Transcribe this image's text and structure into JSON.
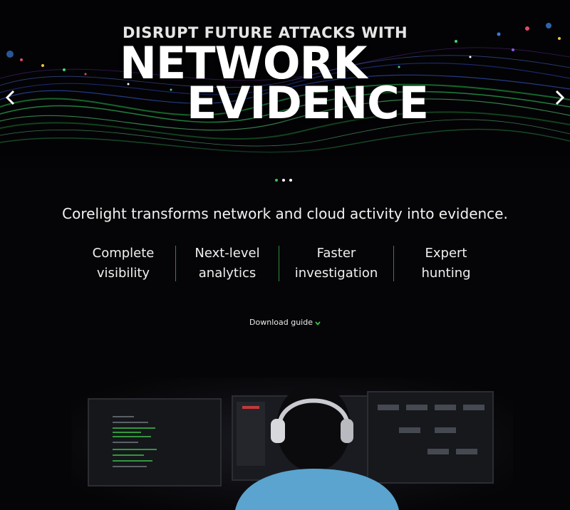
{
  "hero": {
    "kicker": "DISRUPT FUTURE ATTACKS WITH",
    "title_line1": "NETWORK",
    "title_line2": "EVIDENCE",
    "prev_icon": "chevron-left-icon",
    "next_icon": "chevron-right-icon"
  },
  "carousel": {
    "slides": 3,
    "active_index": 0,
    "active_color": "#3ec24a"
  },
  "tagline": "Corelight transforms network and cloud activity into evidence.",
  "features": [
    {
      "line1": "Complete",
      "line2": "visibility"
    },
    {
      "line1": "Next-level",
      "line2": "analytics"
    },
    {
      "line1": "Faster",
      "line2": "investigation"
    },
    {
      "line1": "Expert",
      "line2": "hunting"
    }
  ],
  "cta": {
    "label": "Download guide",
    "icon": "chevron-down-icon"
  },
  "colors": {
    "accent": "#3ec24a",
    "background": "#050507",
    "divider": "#2f8a3b"
  }
}
